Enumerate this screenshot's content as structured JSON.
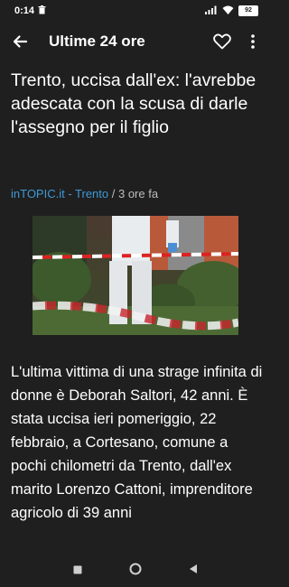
{
  "status_bar": {
    "time": "0:14",
    "battery": "92"
  },
  "toolbar": {
    "title": "Ultime 24 ore"
  },
  "article": {
    "headline": "Trento, uccisa dall'ex: l'avrebbe adescata con la scusa di darle l'assegno per il figlio",
    "source": "inTOPIC.it - Trento",
    "separator": " / ",
    "time_ago": "3 ore fa",
    "body": "L'ultima vittima di una strage infinita di donne è Deborah Saltori, 42 anni. È stata uccisa ieri pomeriggio, 22 febbraio, a Cortesano, comune a pochi chilometri da Trento, dall'ex marito Lorenzo Cattoni, imprenditore agricolo di 39 anni"
  },
  "icons": {
    "status_trash": "trash-icon",
    "back": "arrow-left-icon",
    "favorite": "heart-outline-icon",
    "more": "more-vert-icon",
    "nav_recent": "square-icon",
    "nav_home": "circle-icon",
    "nav_back": "triangle-back-icon"
  },
  "colors": {
    "background": "#1f1f1f",
    "text": "#ffffff",
    "source_link": "#3d9ad6",
    "meta": "#bdbdbd"
  }
}
